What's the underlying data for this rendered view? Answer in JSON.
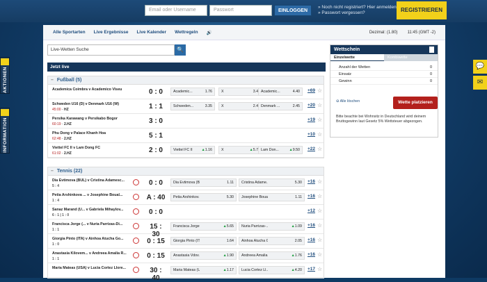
{
  "header": {
    "email_placeholder": "Email oder Username",
    "password_placeholder": "Passwort",
    "login_label": "EINLOGGEN",
    "link1": "» Noch nicht registriert? Hier anmelden.",
    "link2": "» Passwort vergessen?",
    "register_label": "REGISTRIEREN"
  },
  "sidetabs": {
    "aktionen": "AKTIONEN",
    "information": "INFORMATION"
  },
  "nav": {
    "items": [
      "Alle Sportarten",
      "Live Ergebnisse",
      "Live Kalender",
      "Wettregeln"
    ],
    "sound_icon": "🔊",
    "decimal": "Dezimal: (1.80)",
    "time": "11:45 (GMT -2)"
  },
  "search": {
    "placeholder": "Live-Wetten Suche",
    "icon": "🔍"
  },
  "live_header": "Jetzt live",
  "football": {
    "title": "Fußball (5)",
    "matches": [
      {
        "name": "Academica Coimbra v Academico Viseu",
        "score": "0 : 0",
        "more": "+69",
        "odds": [
          {
            "l": "Academic...",
            "v": "1.76"
          },
          {
            "l": "X",
            "v": "3.45"
          },
          {
            "l": "Academic...",
            "v": "4.40"
          }
        ]
      },
      {
        "name": "Schweden U16 (D) v Denmark U16 (W)",
        "min": "45:00",
        "period": "HZ",
        "score": "1 : 1",
        "more": "+20",
        "odds": [
          {
            "l": "Schweden...",
            "v": "3.35"
          },
          {
            "l": "X",
            "v": "2.45"
          },
          {
            "l": "Denmark ...",
            "v": "2.45"
          }
        ]
      },
      {
        "name": "Persika Karawang v Persikabo Bogor",
        "min": "60:19",
        "period": "2.HZ",
        "score": "3 : 0",
        "more": "+19",
        "odds": []
      },
      {
        "name": "Phu Dong v Palace Khanh Hoa",
        "min": "62:48",
        "period": "2.HZ",
        "score": "5 : 1",
        "more": "+10",
        "odds": []
      },
      {
        "name": "Viettel FC II v Lam Dong FC",
        "min": "61:02",
        "period": "2.HZ",
        "score": "2 : 0",
        "more": "+22",
        "odds": [
          {
            "l": "Viettel FC II",
            "v": "1.16",
            "t": "up"
          },
          {
            "l": "X",
            "v": "5.70",
            "t": "up"
          },
          {
            "l": "Lam Don...",
            "v": "9.50",
            "t": "up"
          }
        ]
      }
    ]
  },
  "tennis": {
    "title": "Tennis (22)",
    "matches": [
      {
        "name": "Dia Evtimova (BUL) v Cristina Adamesc...",
        "sets": "5 : 4",
        "score": "0 : 0",
        "more": "+16",
        "odds": [
          {
            "l": "Dia Evtimova (B...",
            "v": "1.11"
          },
          {
            "l": "Cristina Adame...",
            "v": "5.30"
          }
        ]
      },
      {
        "name": "Petia Arshinkova ... v Josephine Boual...",
        "sets": "1 : 4",
        "score": "A : 40",
        "more": "+16",
        "odds": [
          {
            "l": "Petia Arshinkov...",
            "v": "5.30"
          },
          {
            "l": "Josephine Boua...",
            "v": "1.11"
          }
        ]
      },
      {
        "name": "Sanaz Marand (U... v Gabriela Mihaylov...",
        "sets": "6 : 1 | 1 : 0",
        "score": "0 : 0",
        "more": "+12",
        "odds": []
      },
      {
        "name": "Francisca Jorge (... v Nuria Parrizas-Di...",
        "sets": "1 : 1",
        "score": "15 : 30",
        "more": "+16",
        "odds": [
          {
            "l": "Francisca Jorge ...",
            "v": "5.65",
            "t": "up"
          },
          {
            "l": "Nuria Parrizas-...",
            "v": "1.09",
            "t": "up"
          }
        ]
      },
      {
        "name": "Giorgia Pinto (ITA) v Ainhoa Atucha Go...",
        "sets": "1 : 0",
        "score": "0 : 15",
        "more": "+16",
        "odds": [
          {
            "l": "Giorgia Pinto (ITA)",
            "v": "1.64"
          },
          {
            "l": "Ainhoa Atucha G...",
            "v": "2.05"
          }
        ]
      },
      {
        "name": "Anastasia Kilovem... v Andreea Amalia R...",
        "sets": "1 : 1",
        "score": "0 : 15",
        "more": "+16",
        "odds": [
          {
            "l": "Anastasia Vdov...",
            "v": "1.90",
            "t": "up"
          },
          {
            "l": "Andreea Amalia...",
            "v": "1.76",
            "t": "up"
          }
        ]
      },
      {
        "name": "Maria Mateas (USA) v Lucia Cortez Llore...",
        "sets": "",
        "score": "30 : 40",
        "more": "+17",
        "odds": [
          {
            "l": "Maria Mateas (U...",
            "v": "1.17",
            "t": "up"
          },
          {
            "l": "Lucia Cortez Ll...",
            "v": "4.20",
            "t": "up"
          }
        ]
      }
    ]
  },
  "wettschein": {
    "title": "Wettschein",
    "tab1": "Einzelwette",
    "tab2": "Kombiwette",
    "rows": [
      {
        "l": "Anzahl der Wetten",
        "v": "0"
      },
      {
        "l": "Einsatz",
        "v": "0"
      },
      {
        "l": "Gewinn",
        "v": "0"
      }
    ],
    "delete_label": "Alle löschen",
    "place_label": "Wette platzieren",
    "note": "Bitte beachte bei Wohnsitz in Deutschland wird deinem Bruttogewinn laut Gesetz 5% Wettsteuer abgezogen."
  }
}
